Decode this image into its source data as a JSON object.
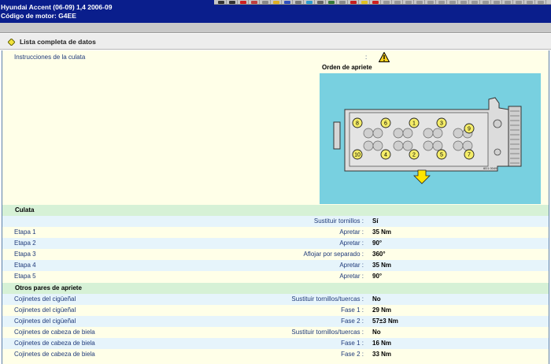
{
  "header": {
    "vehicle": "Hyundai   Accent (06-09) 1,4   2006-09",
    "engine_code": "Código de motor: G4EE"
  },
  "colors": {
    "header_bg": "#0a1e8c",
    "table_alt_row": "#e6f4fb",
    "table_group_row": "#d6f1d6",
    "diagram_bg": "#78d0e0"
  },
  "section": {
    "title": "Lista completa de datos",
    "icon": "yellow-diamond-icon"
  },
  "instructions": {
    "label": "Instrucciones de la culata",
    "colon": ":",
    "icon": "warning-triangle-icon",
    "diagram_title": "Orden de apriete",
    "diagram_code": "6D1 0049",
    "bolts": [
      "8",
      "6",
      "1",
      "3",
      "9",
      "10",
      "4",
      "2",
      "5",
      "7"
    ]
  },
  "groups": [
    {
      "title": "Culata",
      "rows": [
        {
          "name": "",
          "param": "Sustituir tornillos :",
          "value": "Sí"
        },
        {
          "name": "Etapa 1",
          "param": "Apretar :",
          "value": "35 Nm"
        },
        {
          "name": "Etapa 2",
          "param": "Apretar :",
          "value": "90°"
        },
        {
          "name": "Etapa 3",
          "param": "Aflojar por separado :",
          "value": "360°"
        },
        {
          "name": "Etapa 4",
          "param": "Apretar :",
          "value": "35 Nm"
        },
        {
          "name": "Etapa 5",
          "param": "Apretar :",
          "value": "90°"
        }
      ]
    },
    {
      "title": "Otros pares de apriete",
      "rows": [
        {
          "name": "Cojinetes del cigüeñal",
          "param": "Sustituir tornillos/tuercas :",
          "value": "No"
        },
        {
          "name": "Cojinetes del cigüeñal",
          "param": "Fase 1 :",
          "value": "29 Nm"
        },
        {
          "name": "Cojinetes del cigüeñal",
          "param": "Fase 2 :",
          "value": "57±3 Nm"
        },
        {
          "name": "Cojinetes de cabeza de biela",
          "param": "Sustituir tornillos/tuercas :",
          "value": "No"
        },
        {
          "name": "Cojinetes de cabeza de biela",
          "param": "Fase 1 :",
          "value": "16 Nm"
        },
        {
          "name": "Cojinetes de cabeza de biela",
          "param": "Fase 2 :",
          "value": "33 Nm"
        }
      ]
    }
  ]
}
